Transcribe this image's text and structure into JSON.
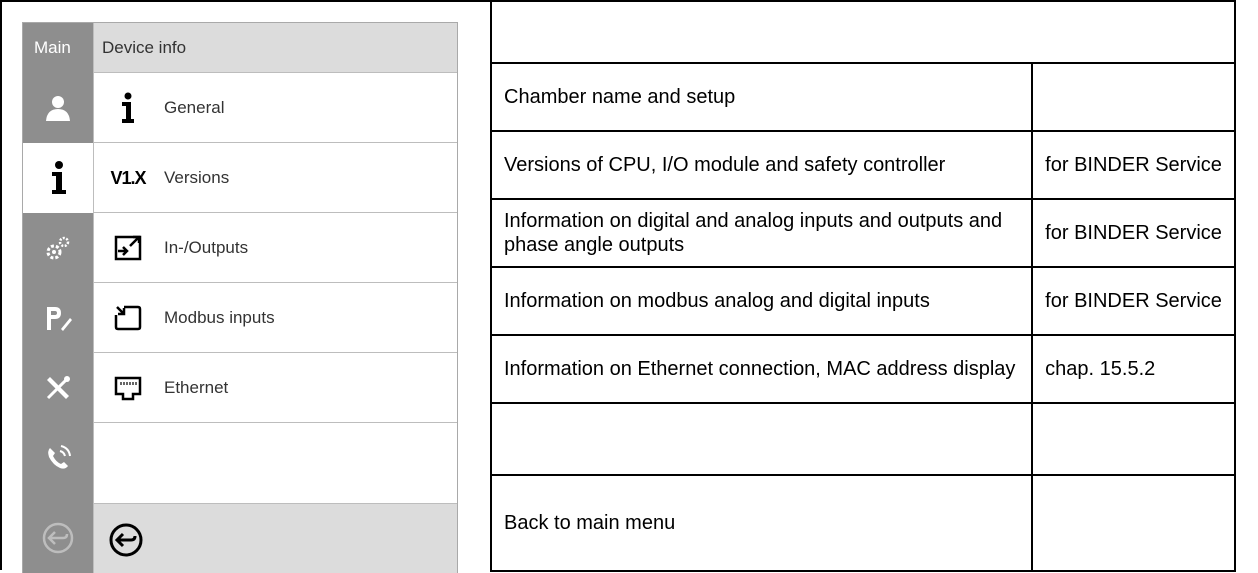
{
  "screen": {
    "sidebar_tab_label": "Main",
    "title": "Device info",
    "menu": [
      {
        "icon": "info-icon",
        "label": "General"
      },
      {
        "icon": "version-v1x-icon",
        "label": "Versions"
      },
      {
        "icon": "in-outputs-icon",
        "label": "In-/Outputs"
      },
      {
        "icon": "modbus-inputs-icon",
        "label": "Modbus inputs"
      },
      {
        "icon": "ethernet-icon",
        "label": "Ethernet"
      }
    ],
    "versions_glyph": "V1.X",
    "sidebar_icons": [
      "user-icon",
      "info-icon",
      "settings-gears-icon",
      "program-edit-icon",
      "service-tools-icon",
      "phone-service-icon",
      "back-icon"
    ],
    "colors": {
      "sidebar": "#8e8e8e",
      "titlebar": "#dcdcdc"
    }
  },
  "table": {
    "rows": [
      {
        "desc": "",
        "note": ""
      },
      {
        "desc": "Chamber name and setup",
        "note": ""
      },
      {
        "desc": "Versions of CPU, I/O module and safety controller",
        "note": "for BINDER Service"
      },
      {
        "desc": "Information on digital and analog inputs and outputs and phase angle outputs",
        "note": "for BINDER Service"
      },
      {
        "desc": "Information on modbus analog and digital inputs",
        "note": "for BINDER Service"
      },
      {
        "desc": "Information on Ethernet connection, MAC address display",
        "note": "chap. 15.5.2"
      },
      {
        "desc": "",
        "note": ""
      },
      {
        "desc": "Back to main menu",
        "note": ""
      }
    ]
  }
}
